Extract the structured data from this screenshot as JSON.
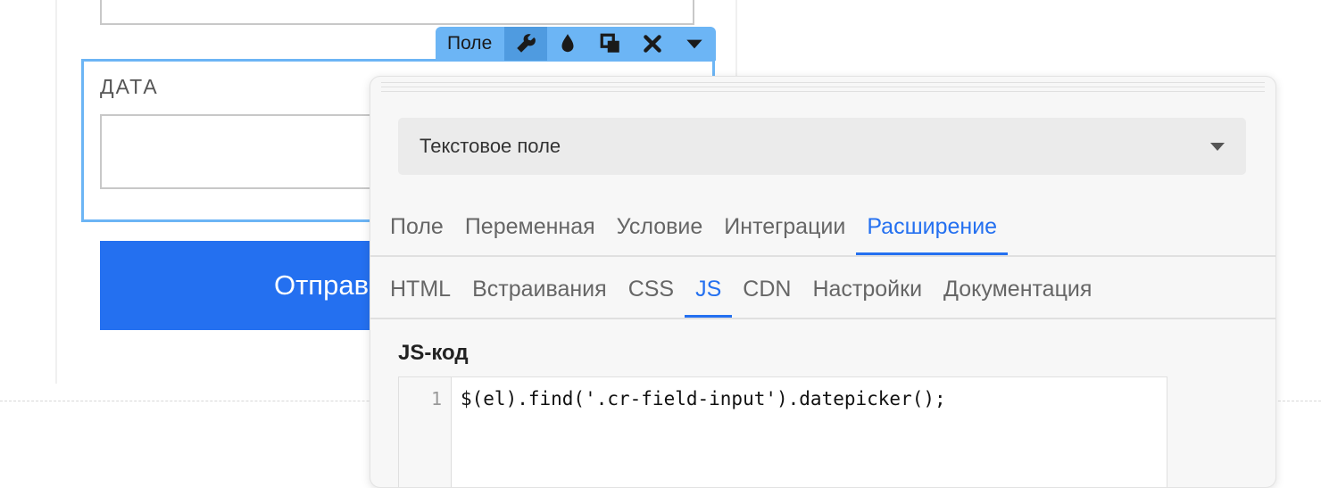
{
  "form": {
    "field_label": "ДАТА",
    "submit_label": "Отправ"
  },
  "toolbar": {
    "label": "Поле",
    "icons": [
      "wrench-icon",
      "drop-icon",
      "copy-icon",
      "close-icon",
      "caret-down-icon"
    ],
    "bg_color": "#6cb5f5"
  },
  "panel": {
    "type_select": {
      "value": "Текстовое поле"
    },
    "main_tabs": [
      "Поле",
      "Переменная",
      "Условие",
      "Интеграции",
      "Расширение"
    ],
    "main_active": "Расширение",
    "sub_tabs": [
      "HTML",
      "Встраивания",
      "CSS",
      "JS",
      "CDN",
      "Настройки",
      "Документация"
    ],
    "sub_active": "JS",
    "section_title": "JS-код",
    "code": {
      "line_number": "1",
      "line": "$(el).find('.cr-field-input').datepicker();"
    }
  },
  "colors": {
    "accent": "#2470f0",
    "button": "#2470f0"
  }
}
